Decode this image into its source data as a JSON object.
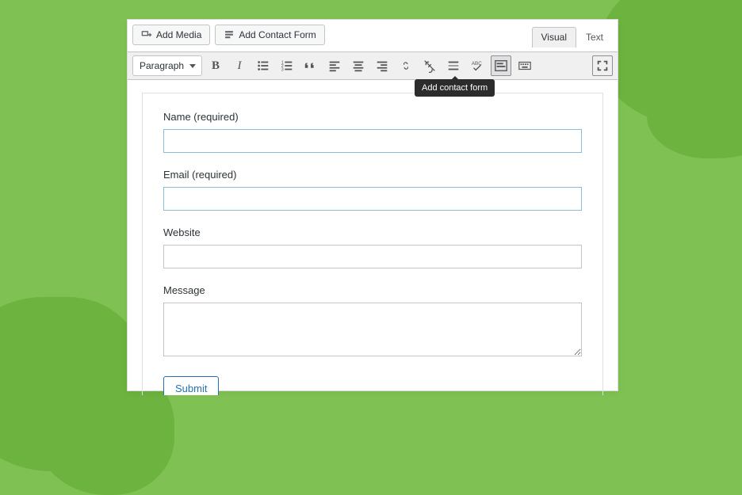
{
  "media_row": {
    "add_media_label": "Add Media",
    "add_contact_label": "Add Contact Form"
  },
  "tabs": {
    "visual": "Visual",
    "text": "Text",
    "active": "visual"
  },
  "toolbar": {
    "format_selector": "Paragraph",
    "tooltip": "Add contact form",
    "icons": [
      {
        "name": "bold-icon",
        "glyph": "B"
      },
      {
        "name": "italic-icon",
        "glyph": "I"
      },
      {
        "name": "bulleted-list-icon"
      },
      {
        "name": "numbered-list-icon"
      },
      {
        "name": "blockquote-icon"
      },
      {
        "name": "align-left-icon"
      },
      {
        "name": "align-center-icon"
      },
      {
        "name": "align-right-icon"
      },
      {
        "name": "link-icon"
      },
      {
        "name": "unlink-icon"
      },
      {
        "name": "read-more-icon"
      },
      {
        "name": "spellcheck-icon"
      },
      {
        "name": "add-contact-form-icon"
      },
      {
        "name": "keyboard-icon"
      }
    ],
    "fullscreen_icon": "fullscreen-icon"
  },
  "form": {
    "fields": [
      {
        "label": "Name (required)",
        "type": "text",
        "value": "",
        "outlined": true
      },
      {
        "label": "Email (required)",
        "type": "text",
        "value": "",
        "outlined": true
      },
      {
        "label": "Website",
        "type": "text",
        "value": "",
        "outlined": false
      },
      {
        "label": "Message",
        "type": "textarea",
        "value": ""
      }
    ],
    "submit_label": "Submit"
  }
}
